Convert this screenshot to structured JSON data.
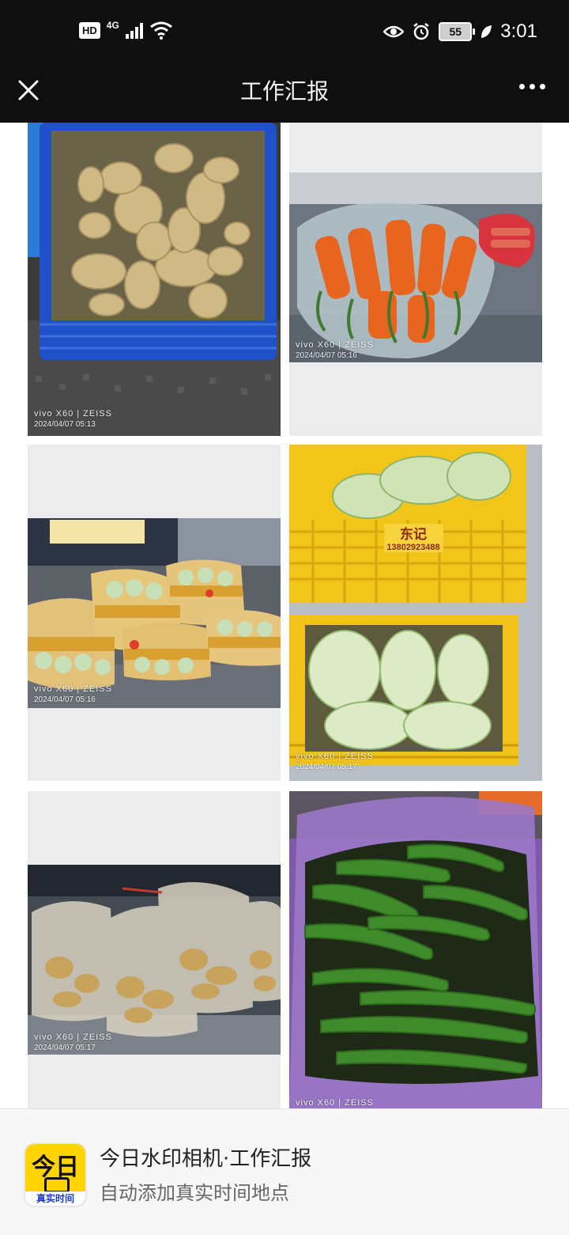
{
  "status": {
    "hd": "HD",
    "network": "4G",
    "battery": "55",
    "time": "3:01"
  },
  "header": {
    "title": "工作汇报"
  },
  "photos": [
    {
      "subject": "potatoes in blue crate",
      "brand": "vivo X60 | ZEISS",
      "datetime": "2024/04/07 05:13"
    },
    {
      "subject": "carrots in plastic bags",
      "brand": "vivo X60 | ZEISS",
      "datetime": "2024/04/07 05:16"
    },
    {
      "subject": "cabbages in printed bags",
      "brand": "vivo X60 | ZEISS",
      "datetime": "2024/04/07 05:16"
    },
    {
      "subject": "napa cabbage in yellow crates",
      "brand": "vivo X60 | ZEISS",
      "datetime": "2024/04/07 05:17",
      "crate_label": "东记",
      "crate_phone": "13802923488"
    },
    {
      "subject": "ginger in plastic bags",
      "brand": "vivo X60 | ZEISS",
      "datetime": "2024/04/07 05:17"
    },
    {
      "subject": "green peppers in purple bag",
      "brand": "vivo X60 | ZEISS"
    }
  ],
  "banner": {
    "app_icon_big": "今日",
    "app_icon_caption": "真实时间",
    "title": "今日水印相机·工作汇报",
    "subtitle": "自动添加真实时间地点"
  }
}
